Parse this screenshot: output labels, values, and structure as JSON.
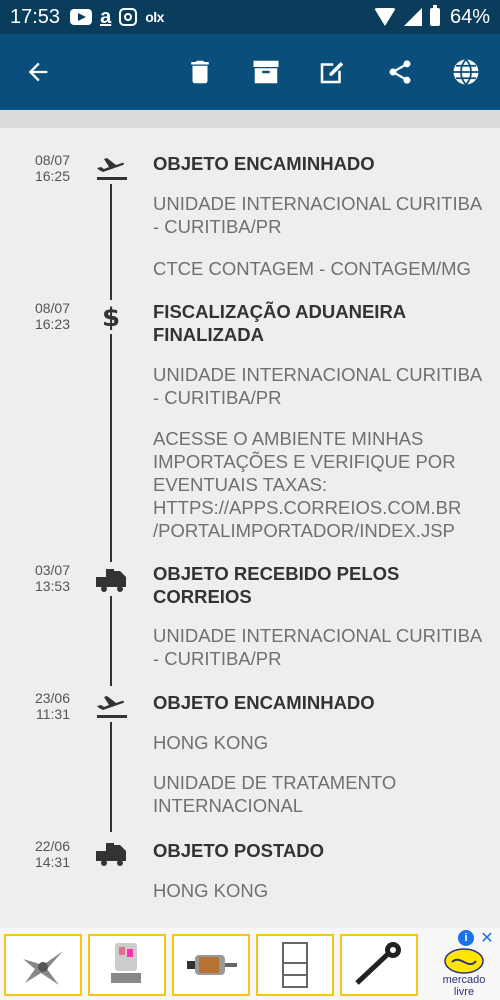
{
  "status_bar": {
    "time": "17:53",
    "app_a": "a",
    "app_olx": "olx",
    "battery": "64%"
  },
  "toolbar": {
    "icons": [
      "back-arrow-icon",
      "trash-icon",
      "archive-icon",
      "edit-icon",
      "share-icon",
      "globe-icon"
    ]
  },
  "events": [
    {
      "date": "08/07",
      "time": "16:25",
      "icon": "airplane-icon",
      "title": "OBJETO ENCAMINHADO",
      "details": [
        "UNIDADE INTERNACIONAL CURITIBA - CURITIBA/PR",
        "CTCE CONTAGEM - CONTAGEM/MG"
      ]
    },
    {
      "date": "08/07",
      "time": "16:23",
      "icon": "dollar-icon",
      "title": "FISCALIZAÇÃO ADUANEIRA FINALIZADA",
      "details": [
        "UNIDADE INTERNACIONAL CURITIBA - CURITIBA/PR",
        "ACESSE O AMBIENTE MINHAS IMPORTAÇÕES E VERIFIQUE POR EVENTUAIS TAXAS: HTTPS://APPS.CORREIOS.COM.BR /PORTALIMPORTADOR/INDEX.JSP"
      ]
    },
    {
      "date": "03/07",
      "time": "13:53",
      "icon": "truck-icon",
      "title": "OBJETO RECEBIDO PELOS CORREIOS",
      "details": [
        "UNIDADE INTERNACIONAL CURITIBA - CURITIBA/PR"
      ]
    },
    {
      "date": "23/06",
      "time": "11:31",
      "icon": "airplane-icon",
      "title": "OBJETO ENCAMINHADO",
      "details": [
        "HONG KONG",
        "UNIDADE DE TRATAMENTO INTERNACIONAL"
      ]
    },
    {
      "date": "22/06",
      "time": "14:31",
      "icon": "truck-icon",
      "title": "OBJETO POSTADO",
      "details": [
        "HONG KONG"
      ]
    }
  ],
  "ad": {
    "brand": "mercado livre",
    "brand_line1": "mercado",
    "brand_line2": "livre",
    "close": "✕",
    "info": "i"
  }
}
